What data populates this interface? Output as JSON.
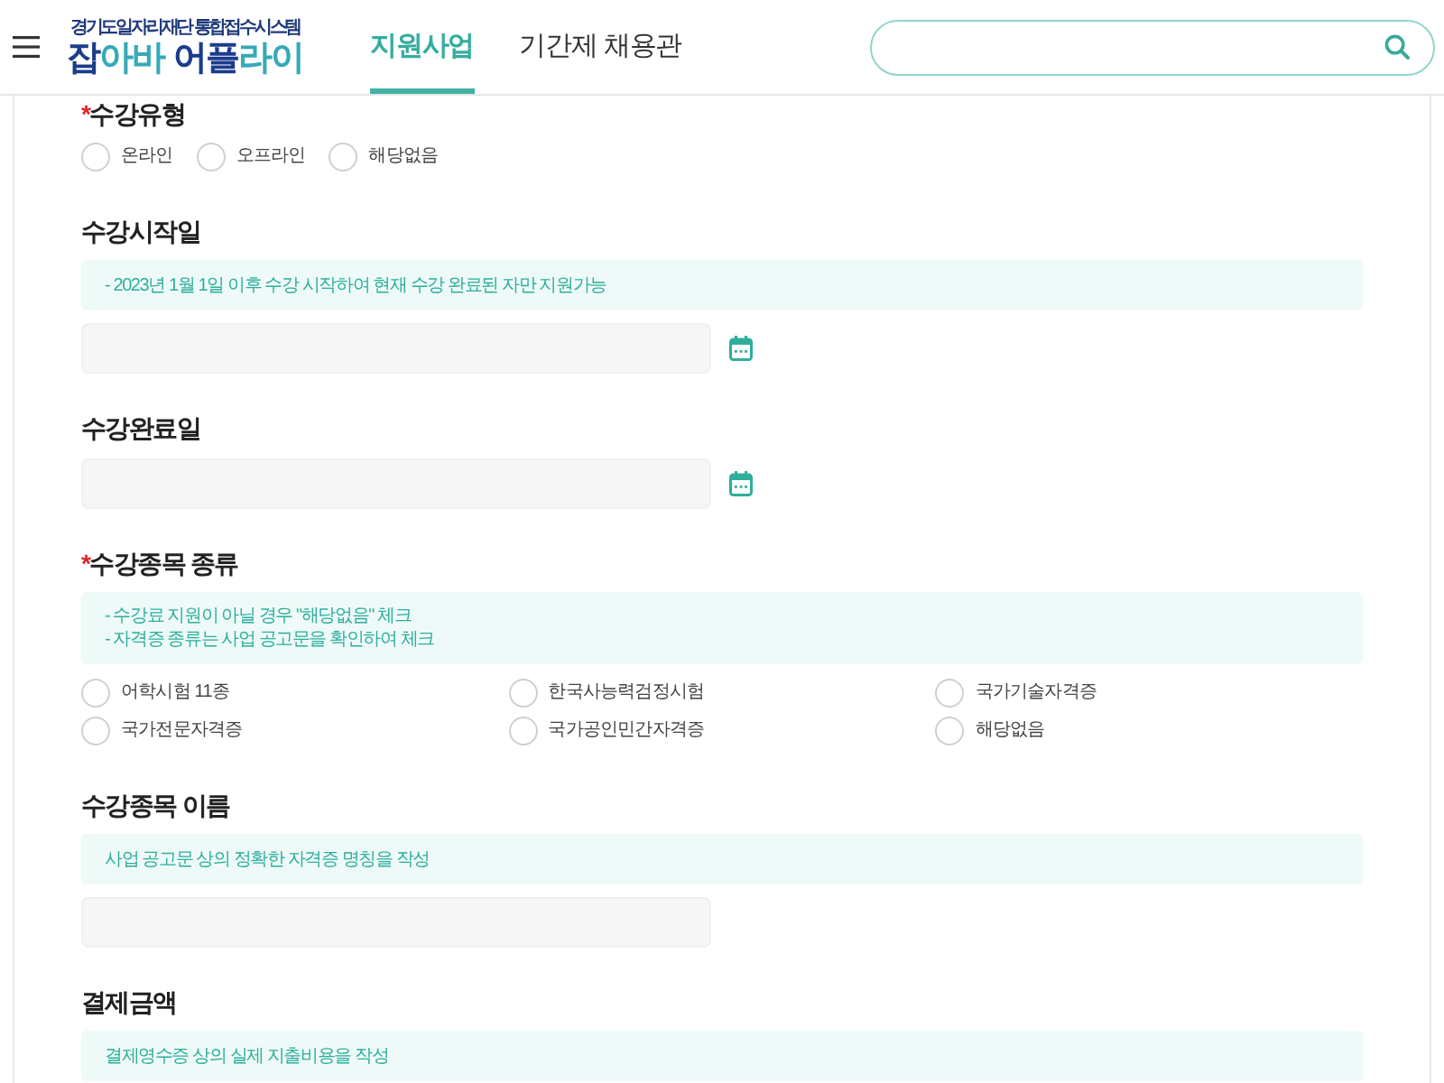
{
  "header": {
    "logo": {
      "tagline": "경기도일자리재단 통합접수시스템",
      "words": [
        [
          {
            "text": "잡",
            "accent": false
          },
          {
            "text": "아바",
            "accent": true
          }
        ],
        [
          {
            "text": "어플",
            "accent": false
          },
          {
            "text": "라이",
            "accent": true
          }
        ]
      ]
    },
    "nav": [
      {
        "label": "지원사업",
        "selected": true
      },
      {
        "label": "기간제 채용관",
        "selected": false
      }
    ]
  },
  "form": {
    "sections": [
      {
        "title": "수강유형",
        "required_mark": "*",
        "grid": false,
        "options": [
          {
            "label": "온라인",
            "selected": false
          },
          {
            "label": "오프라인",
            "selected": false
          },
          {
            "label": "해당없음",
            "selected": false
          }
        ]
      },
      {
        "title": "수강시작일",
        "notes": [
          "- 2023년 1월 1일 이후 수강 시작하여 현재 수강 완료된 자만 지원가능"
        ],
        "field": {
          "kind": "date"
        }
      },
      {
        "title": "수강완료일",
        "field": {
          "kind": "date"
        }
      },
      {
        "title": "수강종목 종류",
        "required_mark": "*",
        "notes": [
          "- 수강료 지원이 아닐 경우 \"해당없음\" 체크",
          "- 자격증 종류는 사업 공고문을 확인하여 체크"
        ],
        "grid": true,
        "options": [
          {
            "label": "어학시험 11종",
            "selected": false
          },
          {
            "label": "한국사능력검정시험",
            "selected": false
          },
          {
            "label": "국가기술자격증",
            "selected": false
          },
          {
            "label": "국가전문자격증",
            "selected": false
          },
          {
            "label": "국가공인민간자격증",
            "selected": false
          },
          {
            "label": "해당없음",
            "selected": false
          }
        ]
      },
      {
        "title": "수강종목 이름",
        "notes": [
          "사업 공고문 상의 정확한 자격증 명칭을 작성"
        ],
        "field": {
          "kind": "text"
        }
      },
      {
        "title": "결제금액",
        "notes": [
          "결제영수증 상의 실제 지출비용을 작성"
        ]
      }
    ]
  }
}
